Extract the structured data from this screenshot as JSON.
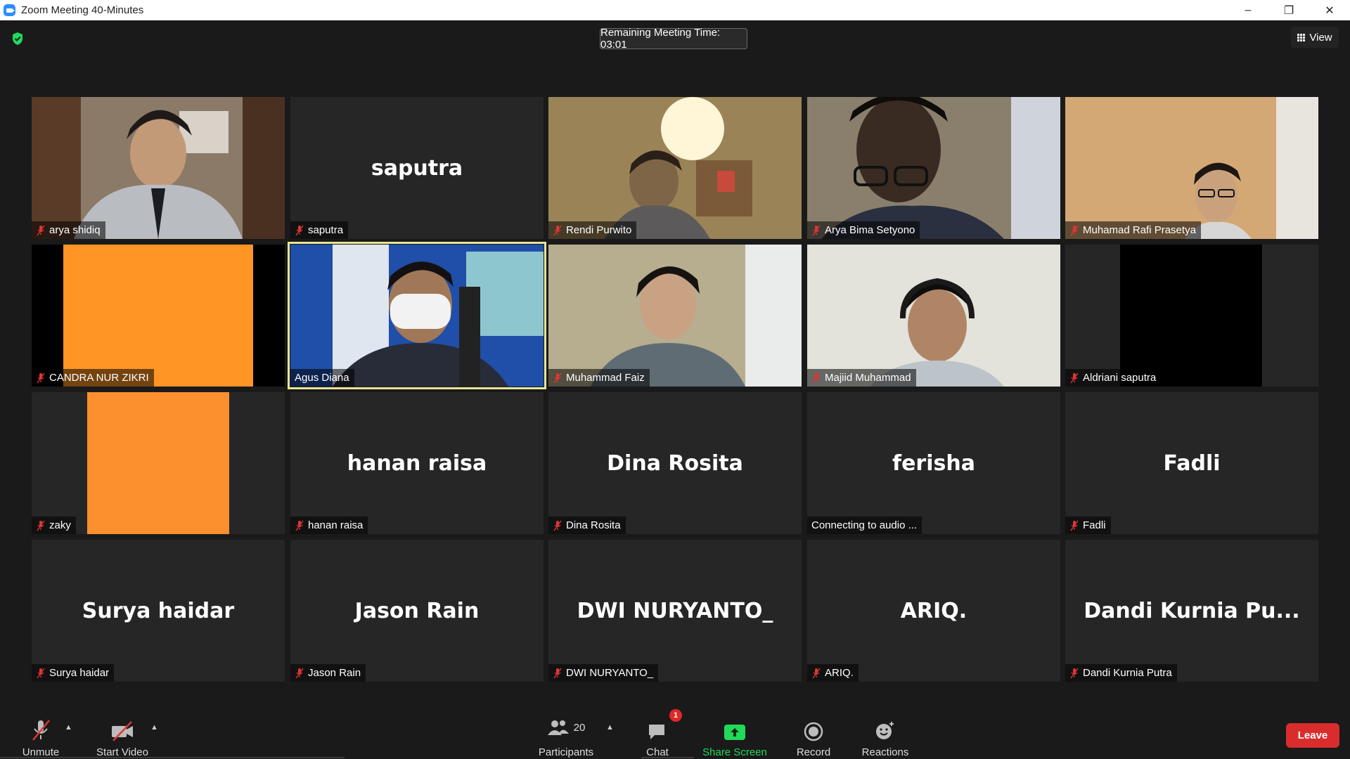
{
  "window": {
    "title": "Zoom Meeting 40-Minutes",
    "minimize": "–",
    "restore": "❐",
    "close": "✕"
  },
  "header": {
    "timer": "Remaining Meeting Time: 03:01",
    "view_label": "View"
  },
  "tiles": [
    {
      "name": "arya shidiq"
    },
    {
      "name": "saputra",
      "center": "saputra"
    },
    {
      "name": "Rendi Purwito"
    },
    {
      "name": "Arya Bima Setyono"
    },
    {
      "name": "Muhamad Rafi Prasetya"
    },
    {
      "name": "CANDRA NUR ZIKRI"
    },
    {
      "name": "Agus Diana"
    },
    {
      "name": "Muhammad Faiz"
    },
    {
      "name": "Majiid Muhammad"
    },
    {
      "name": "Aldriani saputra"
    },
    {
      "name": "zaky"
    },
    {
      "name": "hanan raisa",
      "center": "hanan raisa"
    },
    {
      "name": "Dina Rosita",
      "center": "Dina Rosita"
    },
    {
      "name": "Connecting to audio ...",
      "center": "ferisha"
    },
    {
      "name": "Fadli",
      "center": "Fadli"
    },
    {
      "name": "Surya haidar",
      "center": "Surya haidar"
    },
    {
      "name": "Jason Rain",
      "center": "Jason Rain"
    },
    {
      "name": "DWI NURYANTO_",
      "center": "DWI NURYANTO_"
    },
    {
      "name": "ARIQ.",
      "center": "ARIQ."
    },
    {
      "name": "Dandi Kurnia Putra",
      "center": "Dandi  Kurnia  Pu..."
    }
  ],
  "toolbar": {
    "unmute": "Unmute",
    "start_video": "Start Video",
    "participants": "Participants",
    "participants_count": "20",
    "chat": "Chat",
    "chat_badge": "1",
    "share_screen": "Share Screen",
    "record": "Record",
    "reactions": "Reactions",
    "leave": "Leave"
  },
  "colors": {
    "accent_green": "#23d959",
    "leave_red": "#d92d2d",
    "active_speaker": "#e7e49a",
    "orange_tile": "#ff9524"
  }
}
